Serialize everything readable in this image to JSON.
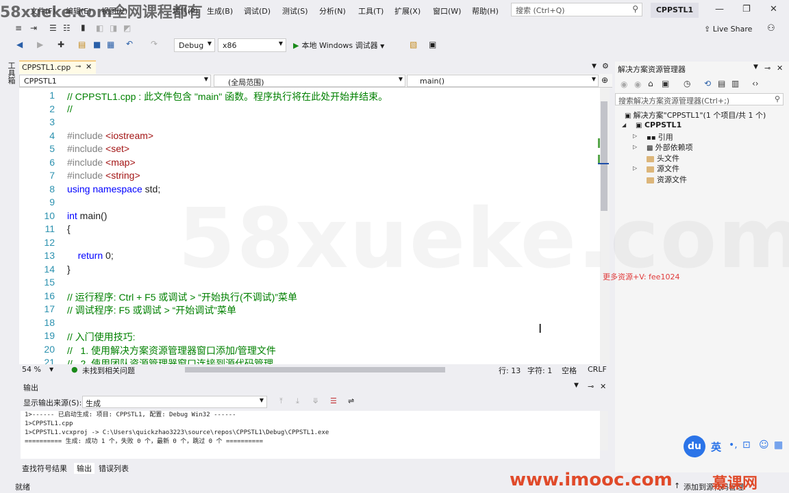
{
  "menu": {
    "items": [
      "文件(F)",
      "编辑(E)",
      "视图(V)",
      "项目(P)",
      "生成(B)",
      "调试(D)",
      "测试(S)",
      "分析(N)",
      "工具(T)",
      "扩展(X)",
      "窗口(W)",
      "帮助(H)"
    ],
    "search_placeholder": "搜索 (Ctrl+Q)",
    "project_badge": "CPPSTL1"
  },
  "toolbar": {
    "config": "Debug",
    "platform": "x86",
    "run_label": "本地 Windows 调试器",
    "live_share": "Live Share"
  },
  "left_tab": "工具箱",
  "document": {
    "tab_name": "CPPSTL1.cpp",
    "nav_project": "CPPSTL1",
    "nav_scope": "(全局范围)",
    "nav_function": "main()"
  },
  "code_lines": [
    {
      "n": "1",
      "segs": [
        {
          "c": "cm",
          "t": "// CPPSTL1.cpp : 此文件包含 \"main\" 函数。程序执行将在此处开始并结束。"
        }
      ]
    },
    {
      "n": "2",
      "segs": [
        {
          "c": "cm",
          "t": "//"
        }
      ]
    },
    {
      "n": "3",
      "segs": []
    },
    {
      "n": "4",
      "segs": [
        {
          "c": "pp",
          "t": "#include "
        },
        {
          "c": "st",
          "t": "<iostream>"
        }
      ]
    },
    {
      "n": "5",
      "segs": [
        {
          "c": "pp",
          "t": "#include "
        },
        {
          "c": "st",
          "t": "<set>"
        }
      ]
    },
    {
      "n": "6",
      "segs": [
        {
          "c": "pp",
          "t": "#include "
        },
        {
          "c": "st",
          "t": "<map>"
        }
      ]
    },
    {
      "n": "7",
      "segs": [
        {
          "c": "pp",
          "t": "#include "
        },
        {
          "c": "st",
          "t": "<string>"
        }
      ]
    },
    {
      "n": "8",
      "segs": [
        {
          "c": "kw",
          "t": "using namespace"
        },
        {
          "c": "",
          "t": " std;"
        }
      ]
    },
    {
      "n": "9",
      "segs": []
    },
    {
      "n": "10",
      "segs": [
        {
          "c": "kw",
          "t": "int"
        },
        {
          "c": "",
          "t": " main()"
        }
      ]
    },
    {
      "n": "11",
      "segs": [
        {
          "c": "",
          "t": "{"
        }
      ]
    },
    {
      "n": "12",
      "segs": []
    },
    {
      "n": "13",
      "segs": [
        {
          "c": "",
          "t": "    "
        },
        {
          "c": "kw",
          "t": "return"
        },
        {
          "c": "",
          "t": " 0;"
        }
      ]
    },
    {
      "n": "14",
      "segs": [
        {
          "c": "",
          "t": "}"
        }
      ]
    },
    {
      "n": "15",
      "segs": []
    },
    {
      "n": "16",
      "segs": [
        {
          "c": "cm",
          "t": "// 运行程序: Ctrl + F5 或调试 > “开始执行(不调试)”菜单"
        }
      ]
    },
    {
      "n": "17",
      "segs": [
        {
          "c": "cm",
          "t": "// 调试程序: F5 或调试 > “开始调试”菜单"
        }
      ]
    },
    {
      "n": "18",
      "segs": []
    },
    {
      "n": "19",
      "segs": [
        {
          "c": "cm",
          "t": "// 入门使用技巧:"
        }
      ]
    },
    {
      "n": "20",
      "segs": [
        {
          "c": "cm",
          "t": "//   1. 使用解决方案资源管理器窗口添加/管理文件"
        }
      ]
    },
    {
      "n": "21",
      "segs": [
        {
          "c": "cm",
          "t": "//   2. 使用团队资源管理器窗口连接到源代码管理"
        }
      ]
    }
  ],
  "editor_status": {
    "zoom": "54 %",
    "issues": "未找到相关问题",
    "line": "行: 13",
    "char": "字符: 1",
    "mode": "空格",
    "eol": "CRLF"
  },
  "output": {
    "title": "输出",
    "source_label": "显示输出来源(S):",
    "source_value": "生成",
    "lines": [
      "1>------ 已启动生成: 项目: CPPSTL1, 配置: Debug Win32 ------",
      "1>CPPSTL1.cpp",
      "1>CPPSTL1.vcxproj -> C:\\Users\\quickzhao3223\\source\\repos\\CPPSTL1\\Debug\\CPPSTL1.exe",
      "========== 生成: 成功 1 个，失败 0 个，最新 0 个，跳过 0 个 =========="
    ]
  },
  "bottom_tabs": [
    "查找符号结果",
    "输出",
    "错误列表"
  ],
  "status_bar": {
    "text": "就绪",
    "right": "添加到源代码管理"
  },
  "solution_explorer": {
    "title": "解决方案资源管理器",
    "search_placeholder": "搜索解决方案资源管理器(Ctrl+;)",
    "solution": "解决方案\"CPPSTL1\"(1 个项目/共 1 个)",
    "project": "CPPSTL1",
    "items": [
      "引用",
      "外部依赖项",
      "头文件",
      "源文件",
      "资源文件"
    ]
  },
  "watermarks": {
    "top": "58xueke.com全网课程都有",
    "center": "58xueke.com",
    "red": "更多资源+V: fee1024",
    "imooc": "www.imooc.com",
    "imooc_brand": "慕课网"
  },
  "ime": {
    "du": "du",
    "lang": "英"
  }
}
